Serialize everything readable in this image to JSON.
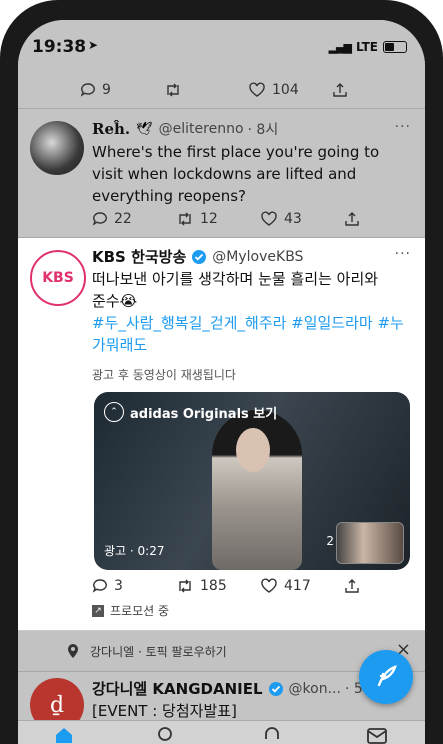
{
  "status": {
    "time": "19:38",
    "network": "LTE"
  },
  "tweet_prev": {
    "replies": "9",
    "retweets": "",
    "likes": "104"
  },
  "tweet1": {
    "user": "Reĥ.",
    "handle": "@eliterenno",
    "age": "· 8시",
    "text": "Where's the first place you're going to visit when lockdowns are lifted and everything reopens?",
    "replies": "22",
    "retweets": "12",
    "likes": "43"
  },
  "tweet2": {
    "user": "KBS 한국방송",
    "handle": "@MyloveKBS",
    "avatar_label": "KBS",
    "text": "떠나보낸 아기를 생각하며 눈물 흘리는 아리와 준수😭",
    "hashtags": "#두_사람_행복길_걷게_해주라 #일일드라마 #누가뭐래도",
    "ad_notice": "광고 후 동영상이 재생됩니다",
    "video_title": "adidas Originals 보기",
    "video_time": "광고 · 0:27",
    "video_count": "2",
    "replies": "3",
    "retweets": "185",
    "likes": "417",
    "promoted": "프로모션 중"
  },
  "topic_bar": {
    "text": "강다니엘 · 토픽 팔로우하기",
    "close": "×"
  },
  "tweet3": {
    "user": "강다니엘 KANGDANIEL",
    "handle": "@kon...",
    "age": "· 5",
    "text": "[EVENT : 당첨자발표]"
  },
  "colors": {
    "accent": "#1d9bf0",
    "verified": "#1d9bf0",
    "kbs": "#e0316e"
  },
  "icons": [
    "reply-icon",
    "retweet-icon",
    "like-icon",
    "share-icon",
    "verified-icon",
    "compose-icon"
  ]
}
